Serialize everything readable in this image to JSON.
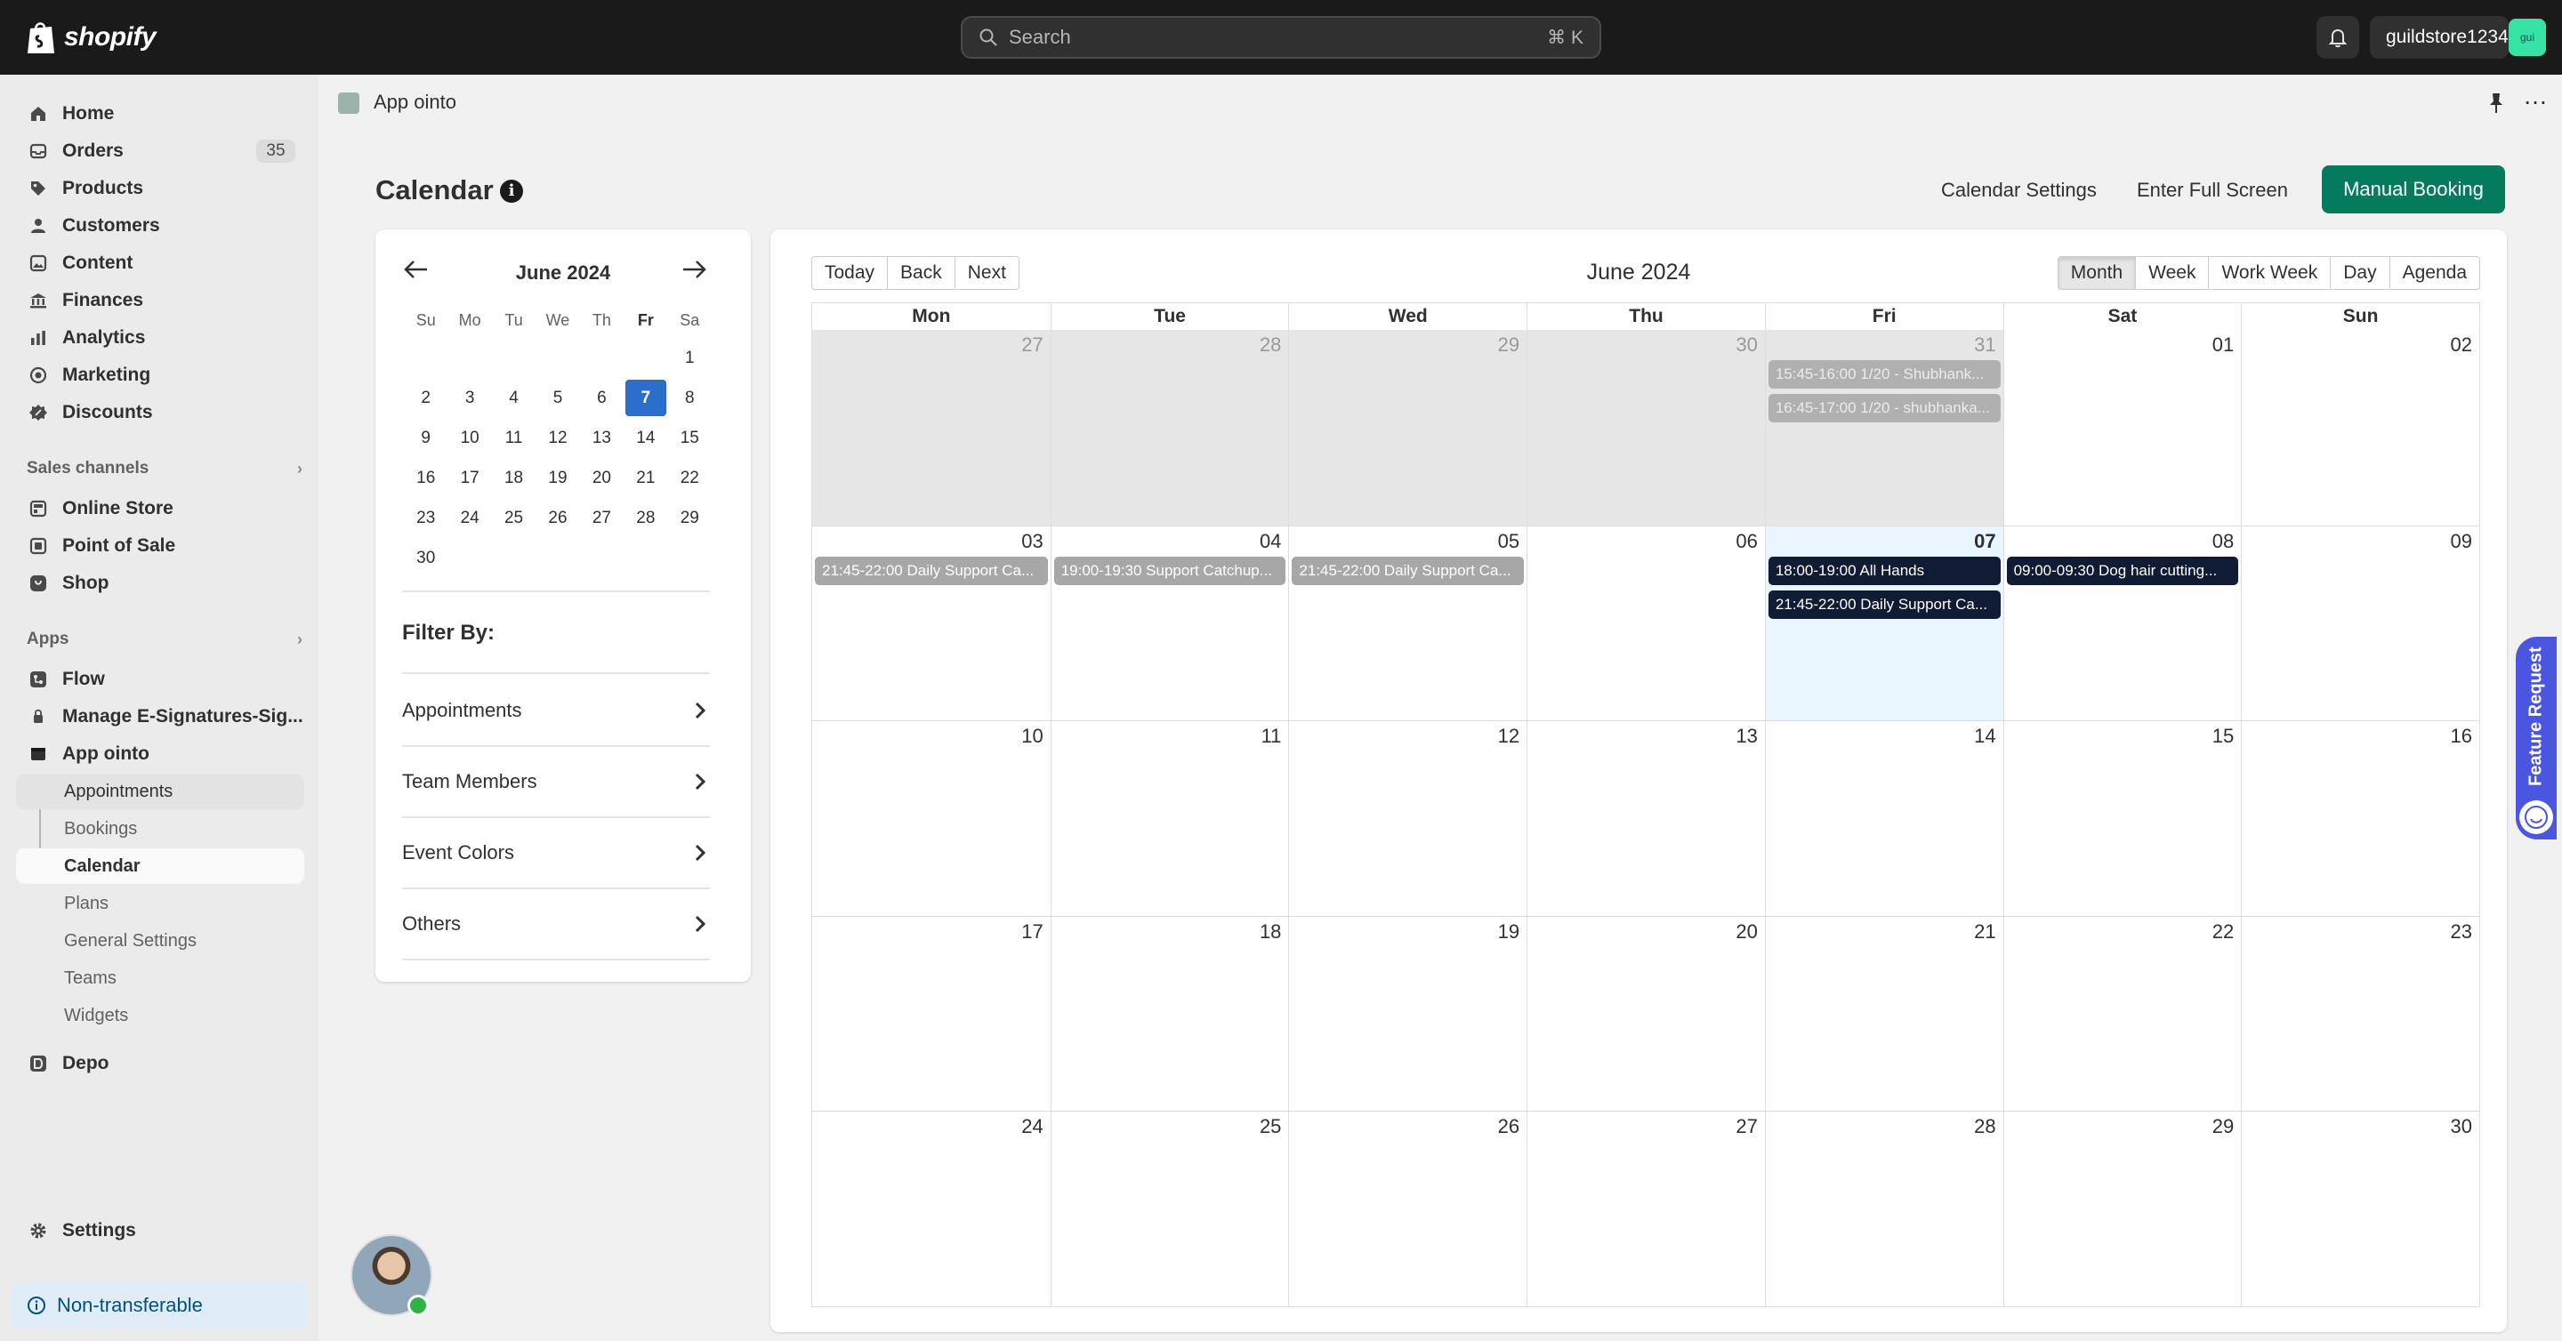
{
  "topbar": {
    "logo_text": "shopify",
    "search_placeholder": "Search",
    "search_shortcut": "⌘ K",
    "store_name": "guildstore1234",
    "store_avatar": "gui"
  },
  "sidebar": {
    "main": [
      {
        "label": "Home",
        "icon": "home-icon"
      },
      {
        "label": "Orders",
        "icon": "orders-icon",
        "badge": "35"
      },
      {
        "label": "Products",
        "icon": "tag-icon"
      },
      {
        "label": "Customers",
        "icon": "person-icon"
      },
      {
        "label": "Content",
        "icon": "content-icon"
      },
      {
        "label": "Finances",
        "icon": "bank-icon"
      },
      {
        "label": "Analytics",
        "icon": "chart-icon"
      },
      {
        "label": "Marketing",
        "icon": "target-icon"
      },
      {
        "label": "Discounts",
        "icon": "discount-icon"
      }
    ],
    "sales_channels_label": "Sales channels",
    "sales_channels": [
      {
        "label": "Online Store",
        "icon": "store-icon"
      },
      {
        "label": "Point of Sale",
        "icon": "pos-icon"
      },
      {
        "label": "Shop",
        "icon": "shop-icon"
      }
    ],
    "apps_label": "Apps",
    "apps": [
      {
        "label": "Flow",
        "icon": "flow-icon"
      },
      {
        "label": "Manage E-Signatures-Sig...",
        "icon": "signature-icon"
      },
      {
        "label": "App ointo",
        "icon": "app-icon"
      }
    ],
    "app_sub": [
      {
        "label": "Appointments"
      },
      {
        "label": "Bookings"
      },
      {
        "label": "Calendar"
      },
      {
        "label": "Plans"
      },
      {
        "label": "General Settings"
      },
      {
        "label": "Teams"
      },
      {
        "label": "Widgets"
      }
    ],
    "depo": "Depo",
    "settings": "Settings",
    "non_transferable": "Non-transferable"
  },
  "app_header": {
    "title": "App ointo"
  },
  "page": {
    "title": "Calendar",
    "calendar_settings": "Calendar Settings",
    "full_screen": "Enter Full Screen",
    "manual_booking": "Manual Booking"
  },
  "mini_calendar": {
    "month": "June 2024",
    "dow": [
      "Su",
      "Mo",
      "Tu",
      "We",
      "Th",
      "Fr",
      "Sa"
    ],
    "days": [
      "",
      "",
      "",
      "",
      "",
      "",
      "1",
      "2",
      "3",
      "4",
      "5",
      "6",
      "7",
      "8",
      "9",
      "10",
      "11",
      "12",
      "13",
      "14",
      "15",
      "16",
      "17",
      "18",
      "19",
      "20",
      "21",
      "22",
      "23",
      "24",
      "25",
      "26",
      "27",
      "28",
      "29",
      "30"
    ],
    "selected": "7"
  },
  "filters": {
    "title": "Filter By:",
    "items": [
      "Appointments",
      "Team Members",
      "Event Colors",
      "Others"
    ]
  },
  "big_calendar": {
    "nav": [
      "Today",
      "Back",
      "Next"
    ],
    "label": "June 2024",
    "views": [
      "Month",
      "Week",
      "Work Week",
      "Day",
      "Agenda"
    ],
    "active_view": "Month",
    "weekdays": [
      "Mon",
      "Tue",
      "Wed",
      "Thu",
      "Fri",
      "Sat",
      "Sun"
    ],
    "weeks": [
      [
        {
          "num": "27",
          "off": true
        },
        {
          "num": "28",
          "off": true
        },
        {
          "num": "29",
          "off": true
        },
        {
          "num": "30",
          "off": true
        },
        {
          "num": "31",
          "off": true,
          "events": [
            {
              "text": "15:45-16:00 1/20 - Shubhank...",
              "style": "faded"
            },
            {
              "text": "16:45-17:00 1/20 - shubhanka...",
              "style": "faded"
            }
          ]
        },
        {
          "num": "01"
        },
        {
          "num": "02"
        }
      ],
      [
        {
          "num": "03",
          "events": [
            {
              "text": "21:45-22:00 Daily Support Ca...",
              "style": "grey"
            }
          ]
        },
        {
          "num": "04",
          "events": [
            {
              "text": "19:00-19:30 Support Catchup...",
              "style": "grey"
            }
          ]
        },
        {
          "num": "05",
          "events": [
            {
              "text": "21:45-22:00 Daily Support Ca...",
              "style": "grey"
            }
          ]
        },
        {
          "num": "06"
        },
        {
          "num": "07",
          "today": true,
          "events": [
            {
              "text": "18:00-19:00 All Hands",
              "style": "dark"
            },
            {
              "text": "21:45-22:00 Daily Support Ca...",
              "style": "dark"
            }
          ]
        },
        {
          "num": "08",
          "events": [
            {
              "text": "09:00-09:30 Dog hair cutting...",
              "style": "dark"
            }
          ]
        },
        {
          "num": "09"
        }
      ],
      [
        {
          "num": "10"
        },
        {
          "num": "11"
        },
        {
          "num": "12"
        },
        {
          "num": "13"
        },
        {
          "num": "14"
        },
        {
          "num": "15"
        },
        {
          "num": "16"
        }
      ],
      [
        {
          "num": "17"
        },
        {
          "num": "18"
        },
        {
          "num": "19"
        },
        {
          "num": "20"
        },
        {
          "num": "21"
        },
        {
          "num": "22"
        },
        {
          "num": "23"
        }
      ],
      [
        {
          "num": "24"
        },
        {
          "num": "25"
        },
        {
          "num": "26"
        },
        {
          "num": "27"
        },
        {
          "num": "28"
        },
        {
          "num": "29"
        },
        {
          "num": "30"
        }
      ]
    ]
  },
  "feature_request": "Feature Request"
}
